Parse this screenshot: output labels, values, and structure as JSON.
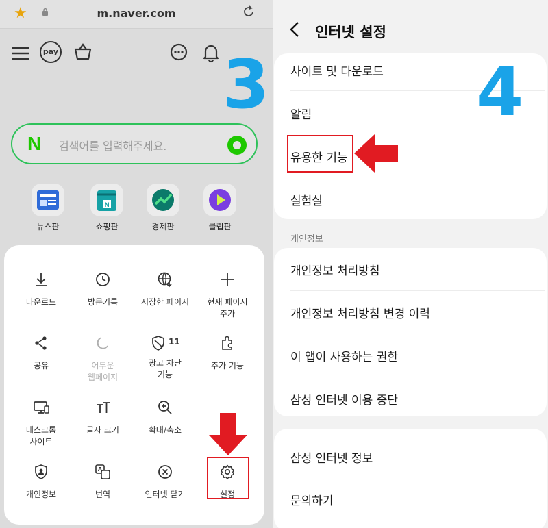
{
  "left": {
    "url": "m.naver.com",
    "step_number": "3",
    "pay_label": "pay",
    "search_placeholder": "검색어를 입력해주세요.",
    "search_logo": "N",
    "quick_links": [
      {
        "label": "뉴스판",
        "icon": "news-icon"
      },
      {
        "label": "쇼핑판",
        "icon": "shopping-bag-icon"
      },
      {
        "label": "경제판",
        "icon": "chart-trend-icon"
      },
      {
        "label": "클립판",
        "icon": "play-icon"
      }
    ],
    "menu": {
      "download": "다운로드",
      "history": "방문기록",
      "saved_pages": "저장한 페이지",
      "add_page_1": "현재 페이지",
      "add_page_2": "추가",
      "share": "공유",
      "dark_1": "어두운",
      "dark_2": "웹페이지",
      "adblock_1": "광고 차단",
      "adblock_2": "기능",
      "adblock_count": "11",
      "addons": "추가 기능",
      "desktop_1": "데스크톱",
      "desktop_2": "사이트",
      "text_size": "글자 크기",
      "zoom": "확대/축소",
      "privacy": "개인정보",
      "translate": "번역",
      "exit": "인터넷 닫기",
      "settings": "설정"
    }
  },
  "right": {
    "title": "인터넷 설정",
    "step_number": "4",
    "group1": [
      "사이트 및 다운로드",
      "알림",
      "유용한 기능",
      "실험실"
    ],
    "section_privacy": "개인정보",
    "group2": [
      "개인정보 처리방침",
      "개인정보 처리방침 변경 이력",
      "이 앱이 사용하는 권한",
      "삼성 인터넷 이용 중단"
    ],
    "group3": [
      "삼성 인터넷 정보",
      "문의하기"
    ]
  },
  "colors": {
    "accent_blue": "#1aa3e8",
    "highlight_red": "#e11b22",
    "naver_green": "#1ec800"
  }
}
